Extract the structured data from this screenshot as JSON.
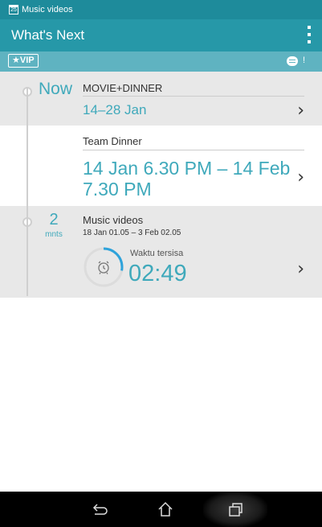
{
  "status_bar": {
    "calendar_day": "25",
    "title": "Music videos"
  },
  "app_bar": {
    "title": "What's Next"
  },
  "vip_bar": {
    "badge": "★VIP",
    "notify": "!"
  },
  "events": [
    {
      "marker": "Now",
      "title": "MOVIE+DINNER",
      "date": "14–28 Jan"
    },
    {
      "title": "Team Dinner",
      "date_line1": "14 Jan 6.30 PM – 14 Feb",
      "date_line2": "7.30 PM"
    },
    {
      "minutes": "2",
      "minutes_unit": "mnts",
      "title": "Music videos",
      "date": "18 Jan 01.05 – 3 Feb 02.05",
      "remaining_label": "Waktu tersisa",
      "remaining_time": "02:49",
      "remaining_progress": 0.28
    }
  ],
  "colors": {
    "accent": "#3fa9bb",
    "status_bar": "#1e8b9b",
    "app_bar": "#2698a8",
    "vip_bar": "#5fb3c1"
  },
  "icons": [
    "calendar-icon",
    "overflow-menu-icon",
    "chat-icon",
    "chevron-right-icon",
    "alarm-clock-icon",
    "back-icon",
    "home-icon",
    "recent-apps-icon"
  ]
}
